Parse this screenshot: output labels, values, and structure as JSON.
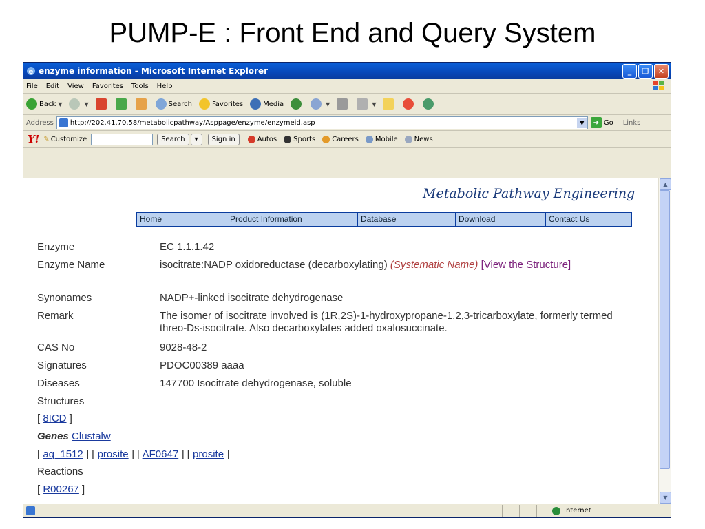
{
  "slide_title": "PUMP-E : Front End and Query System",
  "browser": {
    "window_title": "enzyme information - Microsoft Internet Explorer",
    "menu": [
      "File",
      "Edit",
      "View",
      "Favorites",
      "Tools",
      "Help"
    ],
    "toolbar": {
      "back": "Back",
      "search": "Search",
      "favorites": "Favorites",
      "media": "Media"
    },
    "address_label": "Address",
    "url": "http://202.41.70.58/metabolicpathway/Asppage/enzyme/enzymeid.asp",
    "go": "Go",
    "links": "Links",
    "yahoo": {
      "logo": "Y!",
      "customize": "Customize",
      "search_btn": "Search",
      "signin": "Sign in",
      "items": [
        "Autos",
        "Sports",
        "Careers",
        "Mobile",
        "News"
      ]
    },
    "status_zone": "Internet"
  },
  "page": {
    "brand": "Metabolic Pathway Engineering",
    "nav": [
      "Home",
      "Product Information",
      "Database",
      "Download",
      "Contact Us"
    ],
    "rows": {
      "enzyme": {
        "label": "Enzyme",
        "value": "EC 1.1.1.42"
      },
      "name": {
        "label": "Enzyme Name",
        "value": "isocitrate:NADP oxidoreductase (decarboxylating) ",
        "systematic": "(Systematic Name)",
        "struct_link": "[View the Structure]"
      },
      "synonames": {
        "label": "Synonames",
        "value": "NADP+-linked isocitrate dehydrogenase"
      },
      "remark": {
        "label": "Remark",
        "value": "The isomer of isocitrate involved is (1R,2S)-1-hydroxypropane-1,2,3-tricarboxylate, formerly termed threo-Ds-isocitrate. Also decarboxylates added oxalosuccinate."
      },
      "cas": {
        "label": "CAS No",
        "value": "9028-48-2"
      },
      "signatures": {
        "label": "Signatures",
        "value": "PDOC00389 aaaa"
      },
      "diseases": {
        "label": "Diseases",
        "value": "147700 Isocitrate dehydrogenase, soluble"
      }
    },
    "structures_label": "Structures",
    "structure_link": "8ICD",
    "genes_label": "Genes",
    "clustalw": "Clustalw",
    "genes": [
      {
        "id": "aq_1512",
        "prosite": "prosite"
      },
      {
        "id": "AF0647",
        "prosite": "prosite"
      }
    ],
    "reactions_label": "Reactions",
    "reaction_link": "R00267"
  }
}
